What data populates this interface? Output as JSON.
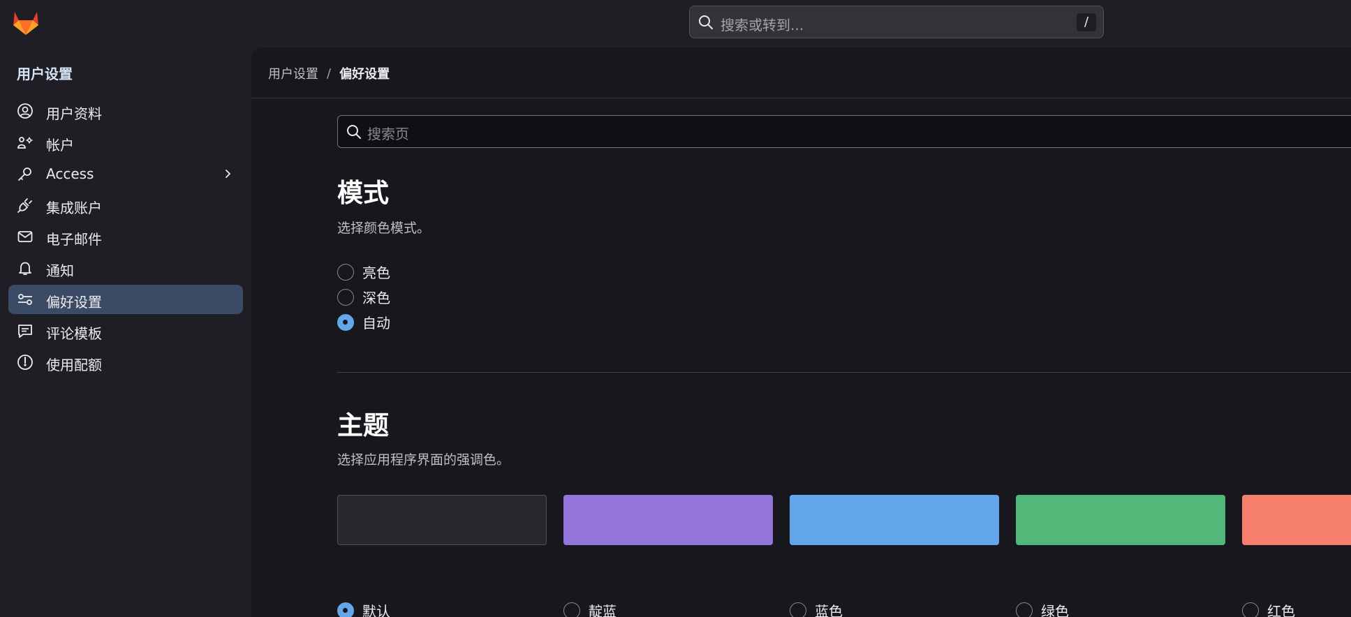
{
  "header": {
    "search_placeholder": "搜索或转到...",
    "search_shortcut": "/"
  },
  "sidebar": {
    "title": "用户设置",
    "items": [
      {
        "label": "用户资料",
        "icon": "profile-icon"
      },
      {
        "label": "帐户",
        "icon": "account-icon"
      },
      {
        "label": "Access",
        "icon": "key-icon"
      },
      {
        "label": "集成账户",
        "icon": "plug-icon"
      },
      {
        "label": "电子邮件",
        "icon": "mail-icon"
      },
      {
        "label": "通知",
        "icon": "bell-icon"
      },
      {
        "label": "偏好设置",
        "icon": "preferences-icon",
        "active": true
      },
      {
        "label": "评论模板",
        "icon": "comment-template-icon"
      },
      {
        "label": "使用配额",
        "icon": "quota-icon"
      }
    ]
  },
  "breadcrumb": {
    "parent": "用户设置",
    "separator": "/",
    "current": "偏好设置"
  },
  "page_search": {
    "placeholder": "搜索页"
  },
  "mode": {
    "title": "模式",
    "description": "选择颜色模式。",
    "options": [
      {
        "label": "亮色",
        "checked": false
      },
      {
        "label": "深色",
        "checked": false
      },
      {
        "label": "自动",
        "checked": true
      }
    ]
  },
  "theme": {
    "title": "主题",
    "description": "选择应用程序界面的强调色。",
    "options": [
      {
        "label": "默认",
        "color": "#28272d",
        "checked": true
      },
      {
        "label": "靛蓝",
        "color": "#9475db",
        "checked": false
      },
      {
        "label": "蓝色",
        "color": "#63a6e9",
        "checked": false
      },
      {
        "label": "绿色",
        "color": "#52b87a",
        "checked": false
      },
      {
        "label": "红色",
        "color": "#f57f6c",
        "checked": false
      }
    ]
  },
  "colors": {
    "accent": "#63a6e9",
    "active_nav": "#3b4b66",
    "logo_orange": "#fc6d26"
  }
}
